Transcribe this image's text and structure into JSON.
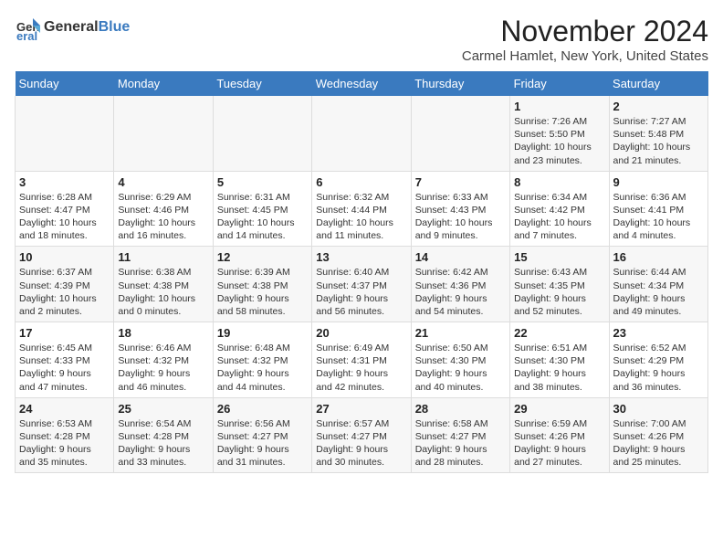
{
  "logo": {
    "general": "General",
    "blue": "Blue"
  },
  "header": {
    "month_title": "November 2024",
    "subtitle": "Carmel Hamlet, New York, United States"
  },
  "days_of_week": [
    "Sunday",
    "Monday",
    "Tuesday",
    "Wednesday",
    "Thursday",
    "Friday",
    "Saturday"
  ],
  "weeks": [
    [
      {
        "day": "",
        "info": ""
      },
      {
        "day": "",
        "info": ""
      },
      {
        "day": "",
        "info": ""
      },
      {
        "day": "",
        "info": ""
      },
      {
        "day": "",
        "info": ""
      },
      {
        "day": "1",
        "info": "Sunrise: 7:26 AM\nSunset: 5:50 PM\nDaylight: 10 hours\nand 23 minutes."
      },
      {
        "day": "2",
        "info": "Sunrise: 7:27 AM\nSunset: 5:48 PM\nDaylight: 10 hours\nand 21 minutes."
      }
    ],
    [
      {
        "day": "3",
        "info": "Sunrise: 6:28 AM\nSunset: 4:47 PM\nDaylight: 10 hours\nand 18 minutes."
      },
      {
        "day": "4",
        "info": "Sunrise: 6:29 AM\nSunset: 4:46 PM\nDaylight: 10 hours\nand 16 minutes."
      },
      {
        "day": "5",
        "info": "Sunrise: 6:31 AM\nSunset: 4:45 PM\nDaylight: 10 hours\nand 14 minutes."
      },
      {
        "day": "6",
        "info": "Sunrise: 6:32 AM\nSunset: 4:44 PM\nDaylight: 10 hours\nand 11 minutes."
      },
      {
        "day": "7",
        "info": "Sunrise: 6:33 AM\nSunset: 4:43 PM\nDaylight: 10 hours\nand 9 minutes."
      },
      {
        "day": "8",
        "info": "Sunrise: 6:34 AM\nSunset: 4:42 PM\nDaylight: 10 hours\nand 7 minutes."
      },
      {
        "day": "9",
        "info": "Sunrise: 6:36 AM\nSunset: 4:41 PM\nDaylight: 10 hours\nand 4 minutes."
      }
    ],
    [
      {
        "day": "10",
        "info": "Sunrise: 6:37 AM\nSunset: 4:39 PM\nDaylight: 10 hours\nand 2 minutes."
      },
      {
        "day": "11",
        "info": "Sunrise: 6:38 AM\nSunset: 4:38 PM\nDaylight: 10 hours\nand 0 minutes."
      },
      {
        "day": "12",
        "info": "Sunrise: 6:39 AM\nSunset: 4:38 PM\nDaylight: 9 hours\nand 58 minutes."
      },
      {
        "day": "13",
        "info": "Sunrise: 6:40 AM\nSunset: 4:37 PM\nDaylight: 9 hours\nand 56 minutes."
      },
      {
        "day": "14",
        "info": "Sunrise: 6:42 AM\nSunset: 4:36 PM\nDaylight: 9 hours\nand 54 minutes."
      },
      {
        "day": "15",
        "info": "Sunrise: 6:43 AM\nSunset: 4:35 PM\nDaylight: 9 hours\nand 52 minutes."
      },
      {
        "day": "16",
        "info": "Sunrise: 6:44 AM\nSunset: 4:34 PM\nDaylight: 9 hours\nand 49 minutes."
      }
    ],
    [
      {
        "day": "17",
        "info": "Sunrise: 6:45 AM\nSunset: 4:33 PM\nDaylight: 9 hours\nand 47 minutes."
      },
      {
        "day": "18",
        "info": "Sunrise: 6:46 AM\nSunset: 4:32 PM\nDaylight: 9 hours\nand 46 minutes."
      },
      {
        "day": "19",
        "info": "Sunrise: 6:48 AM\nSunset: 4:32 PM\nDaylight: 9 hours\nand 44 minutes."
      },
      {
        "day": "20",
        "info": "Sunrise: 6:49 AM\nSunset: 4:31 PM\nDaylight: 9 hours\nand 42 minutes."
      },
      {
        "day": "21",
        "info": "Sunrise: 6:50 AM\nSunset: 4:30 PM\nDaylight: 9 hours\nand 40 minutes."
      },
      {
        "day": "22",
        "info": "Sunrise: 6:51 AM\nSunset: 4:30 PM\nDaylight: 9 hours\nand 38 minutes."
      },
      {
        "day": "23",
        "info": "Sunrise: 6:52 AM\nSunset: 4:29 PM\nDaylight: 9 hours\nand 36 minutes."
      }
    ],
    [
      {
        "day": "24",
        "info": "Sunrise: 6:53 AM\nSunset: 4:28 PM\nDaylight: 9 hours\nand 35 minutes."
      },
      {
        "day": "25",
        "info": "Sunrise: 6:54 AM\nSunset: 4:28 PM\nDaylight: 9 hours\nand 33 minutes."
      },
      {
        "day": "26",
        "info": "Sunrise: 6:56 AM\nSunset: 4:27 PM\nDaylight: 9 hours\nand 31 minutes."
      },
      {
        "day": "27",
        "info": "Sunrise: 6:57 AM\nSunset: 4:27 PM\nDaylight: 9 hours\nand 30 minutes."
      },
      {
        "day": "28",
        "info": "Sunrise: 6:58 AM\nSunset: 4:27 PM\nDaylight: 9 hours\nand 28 minutes."
      },
      {
        "day": "29",
        "info": "Sunrise: 6:59 AM\nSunset: 4:26 PM\nDaylight: 9 hours\nand 27 minutes."
      },
      {
        "day": "30",
        "info": "Sunrise: 7:00 AM\nSunset: 4:26 PM\nDaylight: 9 hours\nand 25 minutes."
      }
    ]
  ]
}
